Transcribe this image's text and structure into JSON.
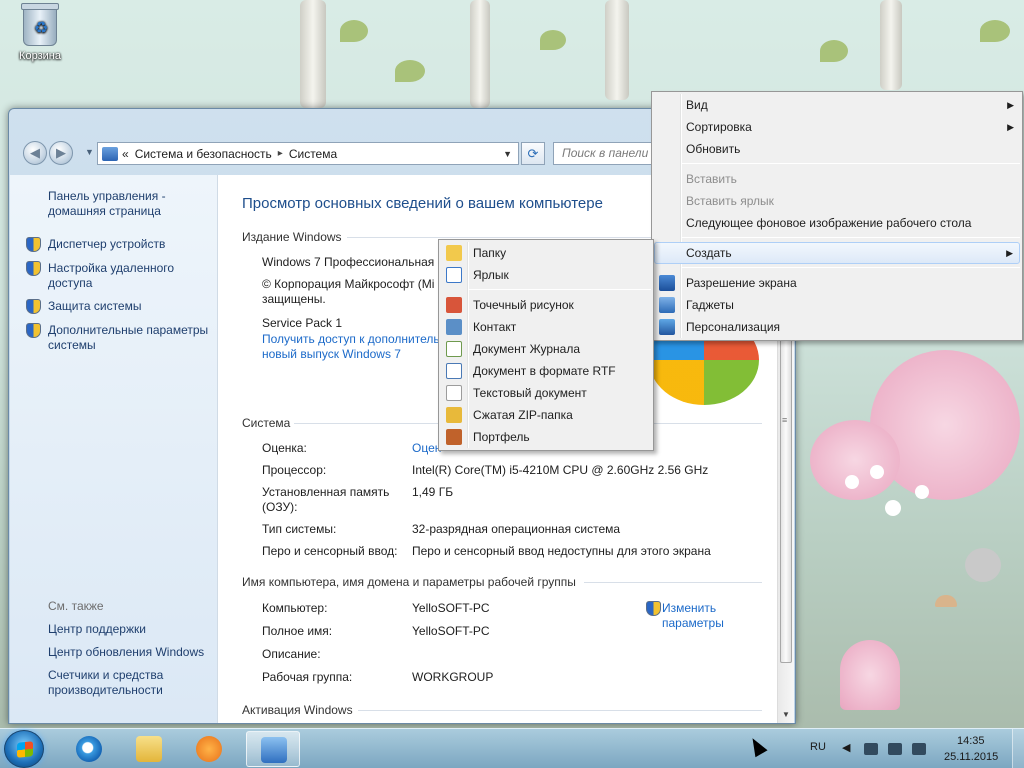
{
  "desktop": {
    "recycle_bin_label": "Корзина"
  },
  "window": {
    "breadcrumb": {
      "chevron": "«",
      "parts": [
        "Система и безопасность",
        "Система"
      ],
      "separator": "▸"
    },
    "search_placeholder": "Поиск в панели управления"
  },
  "sidebar": {
    "home_link": "Панель управления - домашняя страница",
    "links": [
      "Диспетчер устройств",
      "Настройка удаленного доступа",
      "Защита системы",
      "Дополнительные параметры системы"
    ],
    "see_also_title": "См. также",
    "see_also": [
      "Центр поддержки",
      "Центр обновления Windows",
      "Счетчики и средства производительности"
    ]
  },
  "main": {
    "page_title": "Просмотр основных сведений о вашем компьютере",
    "edition": {
      "header": "Издание Windows",
      "name": "Windows 7 Профессиональная",
      "copyright": "© Корпорация Майкрософт (Mi",
      "copyright_line2": "защищены.",
      "service_pack": "Service Pack 1",
      "link_line1": "Получить доступ к дополнитель",
      "link_line2": "новый выпуск Windows 7"
    },
    "system": {
      "header": "Система",
      "rows": [
        {
          "label": "Оценка:",
          "value": "Оцен"
        },
        {
          "label": "Процессор:",
          "value": "Intel(R) Core(TM) i5-4210M CPU @ 2.60GHz   2.56 GHz"
        },
        {
          "label": "Установленная память",
          "label2": "(ОЗУ):",
          "value": "1,49 ГБ"
        },
        {
          "label": "Тип системы:",
          "value": "32-разрядная операционная система"
        },
        {
          "label": "Перо и сенсорный ввод:",
          "value": "Перо и сенсорный ввод недоступны для этого экрана"
        }
      ]
    },
    "computer": {
      "header": "Имя компьютера, имя домена и параметры рабочей группы",
      "change_line1": "Изменить",
      "change_line2": "параметры",
      "rows": [
        {
          "label": "Компьютер:",
          "value": "YelloSOFT-PC"
        },
        {
          "label": "Полное имя:",
          "value": "YelloSOFT-PC"
        },
        {
          "label": "Описание:",
          "value": ""
        },
        {
          "label": "Рабочая группа:",
          "value": "WORKGROUP"
        }
      ]
    },
    "activation_header": "Активация Windows"
  },
  "context_menu": {
    "items": [
      {
        "label": "Вид",
        "submenu": true,
        "disabled": false
      },
      {
        "label": "Сортировка",
        "submenu": true,
        "disabled": false
      },
      {
        "label": "Обновить",
        "submenu": false,
        "disabled": false
      },
      {
        "label": "Вставить",
        "submenu": false,
        "disabled": true
      },
      {
        "label": "Вставить ярлык",
        "submenu": false,
        "disabled": true
      },
      {
        "label": "Следующее фоновое изображение рабочего стола",
        "submenu": false,
        "disabled": false
      },
      {
        "label": "Создать",
        "submenu": true,
        "disabled": false,
        "highlighted": true
      },
      {
        "label": "Разрешение экрана",
        "submenu": false,
        "disabled": false
      },
      {
        "label": "Гаджеты",
        "submenu": false,
        "disabled": false
      },
      {
        "label": "Персонализация",
        "submenu": false,
        "disabled": false
      }
    ],
    "submenu_arrow": "▶"
  },
  "create_submenu": {
    "items": [
      {
        "label": "Папку",
        "icon": "folder-icon",
        "color": "#f2c94c"
      },
      {
        "label": "Ярлык",
        "icon": "shortcut-icon",
        "color": "#3c78c8"
      },
      {
        "label": "Точечный рисунок",
        "icon": "bitmap-icon",
        "color": "#d8553a"
      },
      {
        "label": "Контакт",
        "icon": "contact-icon",
        "color": "#5b8fc7"
      },
      {
        "label": "Документ Журнала",
        "icon": "journal-icon",
        "color": "#6f9a4e"
      },
      {
        "label": "Документ в формате RTF",
        "icon": "rtf-document-icon",
        "color": "#4a79b5"
      },
      {
        "label": "Текстовый документ",
        "icon": "text-document-icon",
        "color": "#d9d9d9"
      },
      {
        "label": "Сжатая ZIP-папка",
        "icon": "zip-folder-icon",
        "color": "#e8b93a"
      },
      {
        "label": "Портфель",
        "icon": "briefcase-icon",
        "color": "#c0622b"
      }
    ]
  },
  "taskbar": {
    "language": "RU",
    "time": "14:35",
    "date": "25.11.2015"
  }
}
